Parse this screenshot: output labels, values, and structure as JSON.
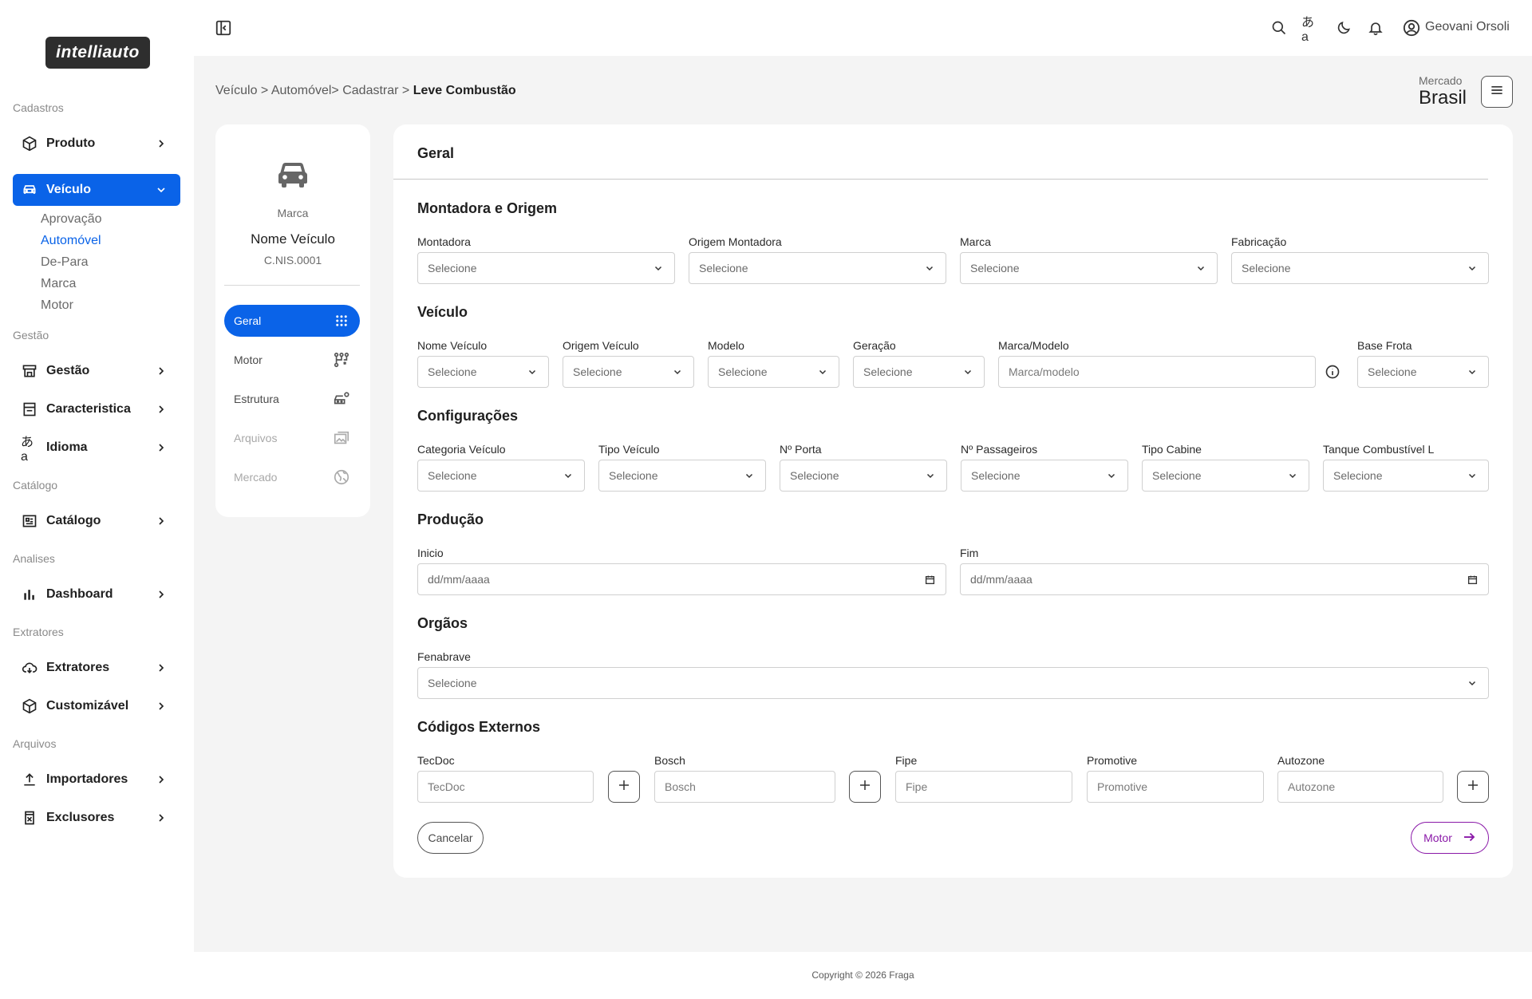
{
  "app": {
    "logo_text": "intelliauto",
    "accent": "#0a63e8",
    "brand_purple": "#8a19a8"
  },
  "sidebar": {
    "sections": [
      "Cadastros",
      "Gestão",
      "Catálogo",
      "Analises",
      "Extratores",
      "Arquivos"
    ],
    "items": [
      {
        "label": "Produto",
        "icon": "box-icon"
      },
      {
        "label": "Veículo",
        "icon": "car-icon"
      },
      {
        "label": "Gestão",
        "icon": "store-icon"
      },
      {
        "label": "Caracteristica",
        "icon": "storefront-icon"
      },
      {
        "label": "Idioma",
        "icon": "translate-icon"
      },
      {
        "label": "Catálogo",
        "icon": "catalog-icon"
      },
      {
        "label": "Dashboard",
        "icon": "bar-chart-icon"
      },
      {
        "label": "Extratores",
        "icon": "cloud-download-icon"
      },
      {
        "label": "Customizável",
        "icon": "box-icon"
      },
      {
        "label": "Importadores",
        "icon": "upload-icon"
      },
      {
        "label": "Exclusores",
        "icon": "delete-file-icon"
      }
    ],
    "veiculo_subitems": [
      "Aprovação",
      "Automóvel",
      "De-Para",
      "Marca",
      "Motor"
    ]
  },
  "topbar": {
    "user_name": "Geovani Orsoli"
  },
  "breadcrumb": {
    "path": "Veículo > Automóvel> Cadastrar > ",
    "current": "Leve Combustão"
  },
  "market": {
    "label": "Mercado",
    "value": "Brasil"
  },
  "vehicle_card": {
    "marca": "Marca",
    "nome": "Nome Veículo",
    "code": "C.NIS.0001",
    "steps": [
      {
        "label": "Geral",
        "state": "active"
      },
      {
        "label": "Motor",
        "state": "normal"
      },
      {
        "label": "Estrutura",
        "state": "normal"
      },
      {
        "label": "Arquivos",
        "state": "disabled"
      },
      {
        "label": "Mercado",
        "state": "disabled"
      }
    ]
  },
  "form": {
    "title": "Geral",
    "sections": {
      "montadora": "Montadora e Origem",
      "veiculo": "Veículo",
      "config": "Configurações",
      "producao": "Produção",
      "orgaos": "Orgãos",
      "codigos": "Códigos Externos"
    },
    "select_placeholder": "Selecione",
    "date_placeholder": "dd/mm/aaaa",
    "montadora_fields": [
      "Montadora",
      "Origem Montadora",
      "Marca",
      "Fabricação"
    ],
    "veiculo_fields": [
      "Nome Veículo",
      "Origem Veículo",
      "Modelo",
      "Geração",
      "Marca/Modelo",
      "Base Frota"
    ],
    "marca_modelo_placeholder": "Marca/modelo",
    "config_fields": [
      "Categoria Veículo",
      "Tipo Veículo",
      "Nº Porta",
      "Nº Passageiros",
      "Tipo Cabine",
      "Tanque Combustível L"
    ],
    "producao_fields": [
      "Inicio",
      "Fim"
    ],
    "orgaos_fields": [
      "Fenabrave"
    ],
    "codigos_fields": [
      "TecDoc",
      "Bosch",
      "Fipe",
      "Promotive",
      "Autozone"
    ],
    "cancel_label": "Cancelar",
    "next_label": "Motor"
  },
  "footer": {
    "copyright": "Copyright © 2026 Fraga"
  }
}
